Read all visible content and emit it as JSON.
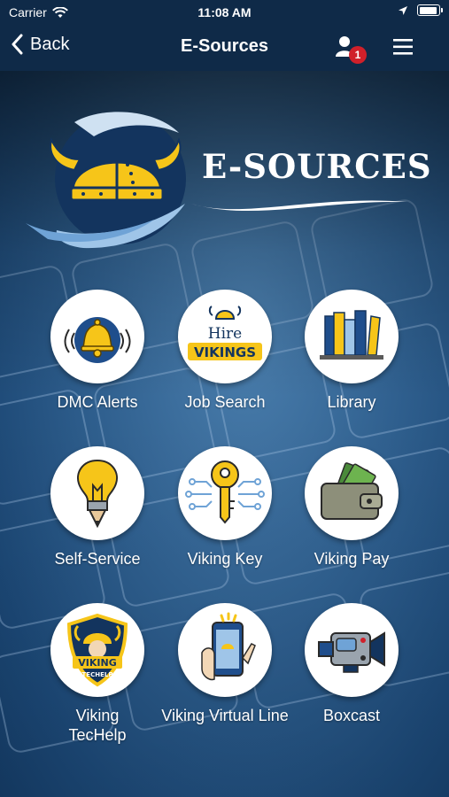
{
  "status_bar": {
    "carrier": "Carrier",
    "time": "11:08 AM"
  },
  "nav": {
    "back_label": "Back",
    "title": "E-Sources",
    "notification_count": "1"
  },
  "banner": {
    "title": "E-SOURCES"
  },
  "tiles": [
    {
      "label": "DMC Alerts",
      "icon": "bell-icon"
    },
    {
      "label": "Job Search",
      "icon": "hire-vikings-icon",
      "icon_text_1": "Hire",
      "icon_text_2": "VIKINGS"
    },
    {
      "label": "Library",
      "icon": "books-icon"
    },
    {
      "label": "Self-Service",
      "icon": "lightbulb-pencil-icon"
    },
    {
      "label": "Viking Key",
      "icon": "key-circuit-icon"
    },
    {
      "label": "Viking Pay",
      "icon": "wallet-icon"
    },
    {
      "label": "Viking TecHelp",
      "icon": "techelp-shield-icon",
      "icon_text_1": "VIKING",
      "icon_text_2": "TECHELP"
    },
    {
      "label": "Viking Virtual Line",
      "icon": "phone-hand-icon"
    },
    {
      "label": "Boxcast",
      "icon": "video-camera-icon"
    }
  ],
  "colors": {
    "nav_bg": "#0f2a48",
    "accent_yellow": "#f6c519",
    "accent_blue": "#1f4e8c",
    "badge_red": "#d0202a"
  }
}
